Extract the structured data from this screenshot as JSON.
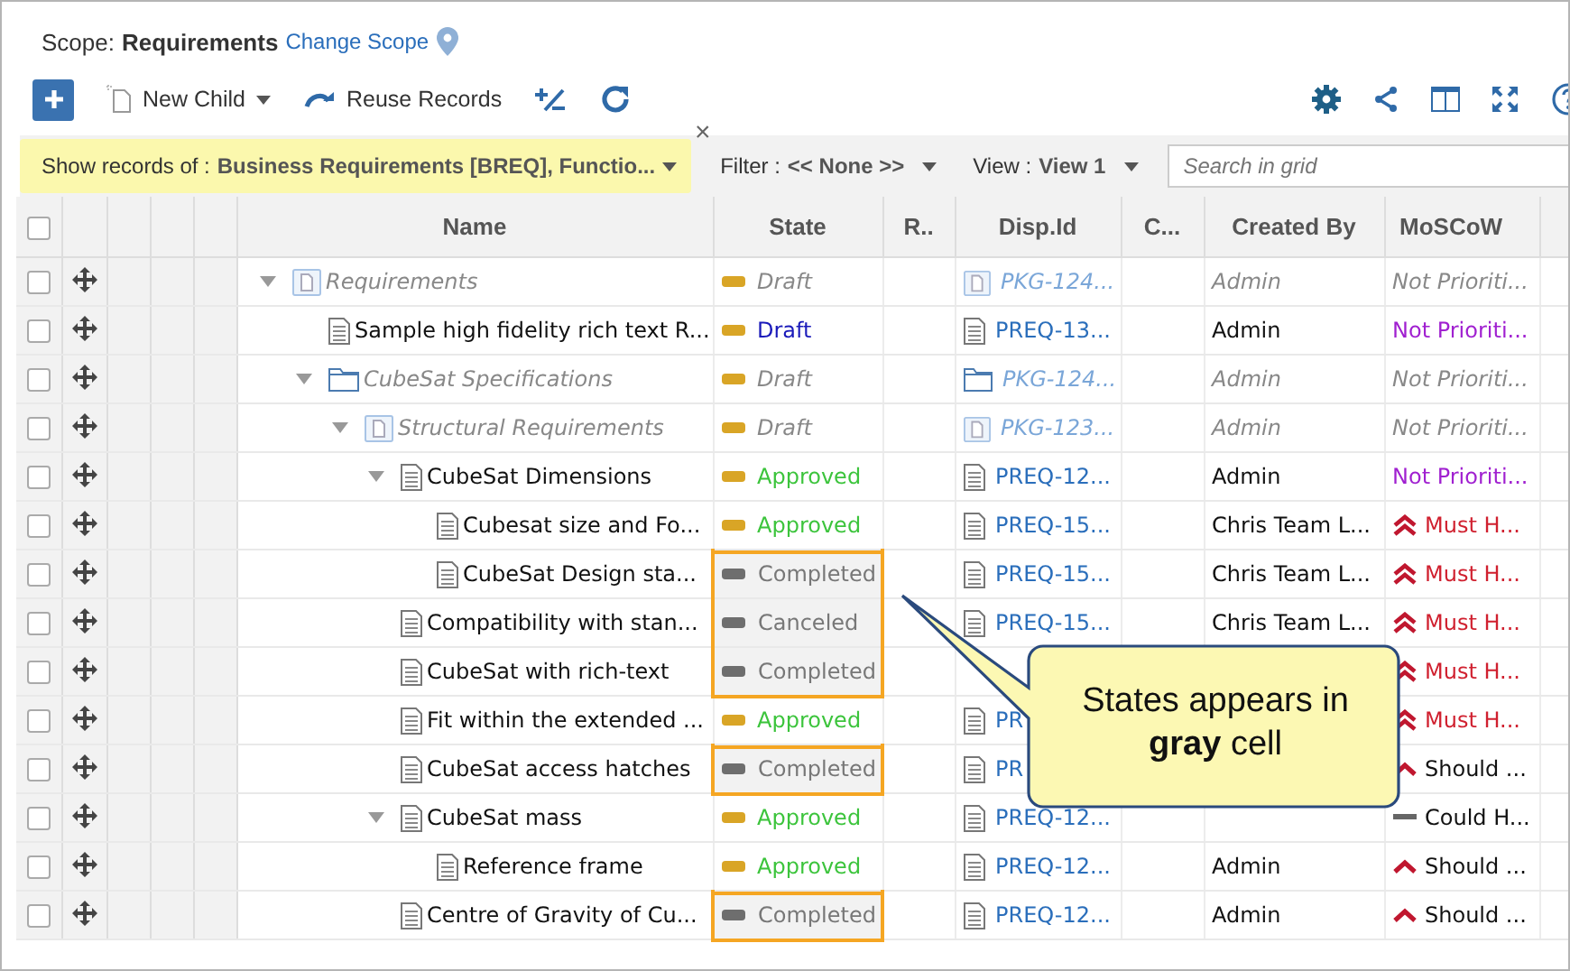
{
  "scope": {
    "label": "Scope:",
    "name": "Requirements",
    "link": "Change Scope"
  },
  "toolbar": {
    "new_child": "New Child",
    "reuse": "Reuse Records"
  },
  "filter_bar": {
    "records_label": "Show records of :",
    "records_value": "Business Requirements [BREQ], Functio...",
    "close": "×",
    "filter_label": "Filter :",
    "filter_value": "<< None >>",
    "view_label": "View :",
    "view_value": "View 1",
    "search_placeholder": "Search in grid"
  },
  "columns": [
    "Name",
    "State",
    "R..",
    "Disp.Id",
    "C...",
    "Created By",
    "MoSCoW"
  ],
  "select_all_checked": false,
  "rows": [
    {
      "kind": "package",
      "name": "Requirements",
      "expanded": true,
      "checked": false,
      "state": {
        "kind": "draft",
        "label": "Draft"
      },
      "disp_id": "PKG-124...",
      "created_by": "Admin",
      "moscow": {
        "kind": "none",
        "label": "Not Prioriti..."
      },
      "children": [
        {
          "kind": "document",
          "name": "Sample high fidelity rich text R...",
          "checked": false,
          "state": {
            "kind": "draft",
            "label": "Draft"
          },
          "disp_id": "PREQ-13...",
          "created_by": "Admin",
          "moscow": {
            "kind": "none",
            "label": "Not Prioriti..."
          }
        },
        {
          "kind": "folder",
          "name": "CubeSat Specifications",
          "expanded": true,
          "checked": false,
          "state": {
            "kind": "draft",
            "label": "Draft"
          },
          "disp_id": "PKG-124...",
          "created_by": "Admin",
          "moscow": {
            "kind": "none",
            "label": "Not Prioriti..."
          },
          "children": [
            {
              "kind": "package",
              "name": "Structural Requirements",
              "expanded": true,
              "checked": false,
              "state": {
                "kind": "draft",
                "label": "Draft"
              },
              "disp_id": "PKG-123...",
              "created_by": "Admin",
              "moscow": {
                "kind": "none",
                "label": "Not Prioriti..."
              },
              "children": [
                {
                  "kind": "document",
                  "name": "CubeSat Dimensions",
                  "expanded": true,
                  "checked": false,
                  "state": {
                    "kind": "approved",
                    "label": "Approved"
                  },
                  "disp_id": "PREQ-12...",
                  "created_by": "Admin",
                  "moscow": {
                    "kind": "none",
                    "label": "Not Prioriti..."
                  },
                  "children": [
                    {
                      "kind": "document",
                      "name": "Cubesat size and Fo...",
                      "checked": false,
                      "state": {
                        "kind": "approved",
                        "label": "Approved"
                      },
                      "disp_id": "PREQ-15...",
                      "created_by": "Chris Team L...",
                      "moscow": {
                        "kind": "must",
                        "label": "Must H..."
                      }
                    },
                    {
                      "kind": "document",
                      "name": "CubeSat Design sta...",
                      "checked": false,
                      "state": {
                        "kind": "completed",
                        "label": "Completed"
                      },
                      "highlighted": true,
                      "disp_id": "PREQ-15...",
                      "created_by": "Chris Team L...",
                      "moscow": {
                        "kind": "must",
                        "label": "Must H..."
                      }
                    }
                  ]
                },
                {
                  "kind": "document",
                  "name": "Compatibility with stan...",
                  "checked": false,
                  "state": {
                    "kind": "canceled",
                    "label": "Canceled"
                  },
                  "highlighted": true,
                  "disp_id": "PREQ-15...",
                  "created_by": "Chris Team L...",
                  "moscow": {
                    "kind": "must",
                    "label": "Must H..."
                  }
                },
                {
                  "kind": "document",
                  "name": "CubeSat with rich-text",
                  "checked": false,
                  "state": {
                    "kind": "completed",
                    "label": "Completed"
                  },
                  "highlighted": true,
                  "moscow": {
                    "kind": "must",
                    "label": "Must H..."
                  }
                },
                {
                  "kind": "document",
                  "name": "Fit within the extended ...",
                  "checked": false,
                  "state": {
                    "kind": "approved",
                    "label": "Approved"
                  },
                  "highlighted": false,
                  "disp_id": "PR",
                  "moscow": {
                    "kind": "must",
                    "label": "Must H..."
                  }
                },
                {
                  "kind": "document",
                  "name": "CubeSat access hatches",
                  "checked": false,
                  "state": {
                    "kind": "completed",
                    "label": "Completed"
                  },
                  "highlighted": true,
                  "disp_id": "PR",
                  "moscow": {
                    "kind": "should",
                    "label": "Should ..."
                  }
                },
                {
                  "kind": "document",
                  "name": "CubeSat mass",
                  "expanded": true,
                  "checked": false,
                  "state": {
                    "kind": "approved",
                    "label": "Approved"
                  },
                  "highlighted": false,
                  "disp_id": "PREQ-12...",
                  "moscow": {
                    "kind": "could",
                    "label": "Could H..."
                  },
                  "children": [
                    {
                      "kind": "document",
                      "name": "Reference frame",
                      "checked": false,
                      "state": {
                        "kind": "approved",
                        "label": "Approved"
                      },
                      "disp_id": "PREQ-12...",
                      "created_by": "Admin",
                      "moscow": {
                        "kind": "should",
                        "label": "Should ..."
                      }
                    }
                  ]
                },
                {
                  "kind": "document",
                  "name": "Centre of Gravity of Cu...",
                  "checked": false,
                  "state": {
                    "kind": "completed",
                    "label": "Completed"
                  },
                  "highlighted": true,
                  "disp_id": "PREQ-12...",
                  "created_by": "Admin",
                  "moscow": {
                    "kind": "should",
                    "label": "Should ..."
                  }
                }
              ]
            }
          ]
        }
      ]
    }
  ],
  "callout": {
    "text": "States appears in **gray** cell"
  }
}
